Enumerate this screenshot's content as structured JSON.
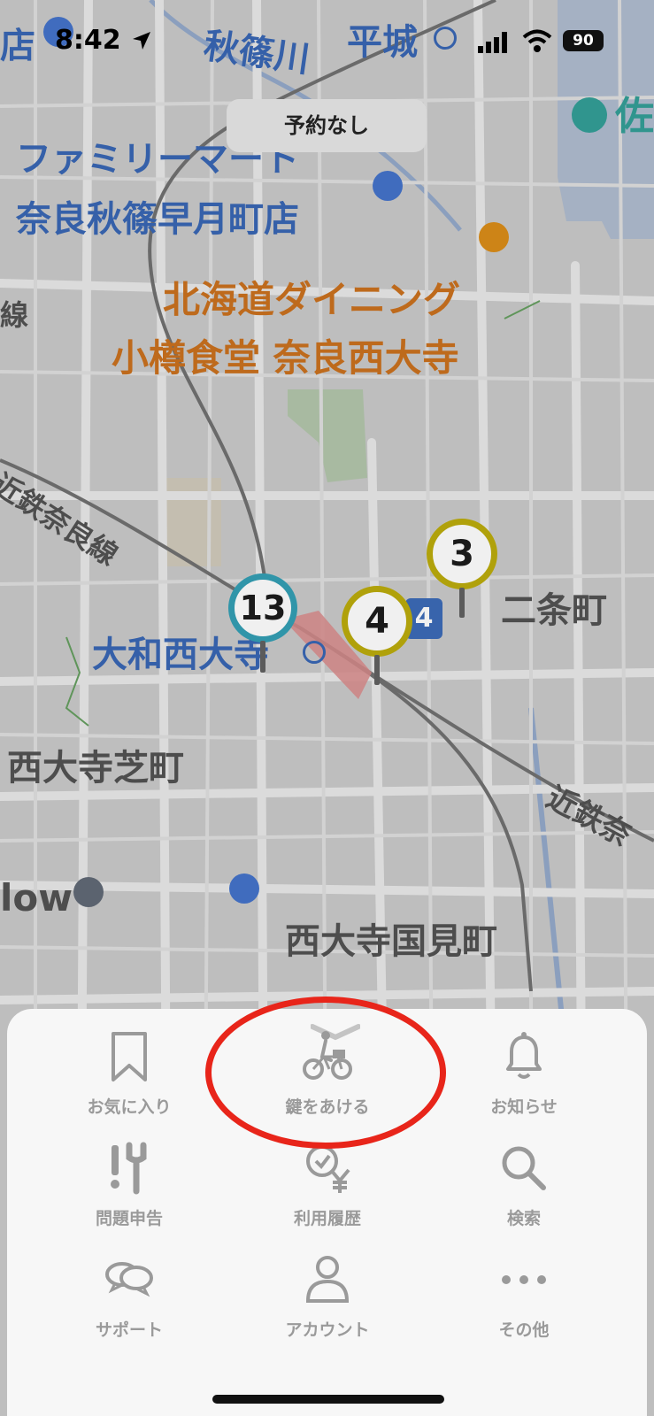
{
  "status_bar": {
    "time": "8:42",
    "battery": "90"
  },
  "reservation_status": "予約なし",
  "map_labels": {
    "edge_top_left": "店",
    "river": "秋篠川",
    "station_heijo": "平城",
    "edge_top_right": "佐",
    "familymart_line1": "ファミリーマート",
    "familymart_line2": "奈良秋篠早月町店",
    "restaurant_line1": "北海道ダイニング",
    "restaurant_line2": "小樽食堂 奈良西大寺",
    "edge_left": "線",
    "railway_west": "近鉄奈良線",
    "station_yamato": "大和西大寺",
    "nijo": "二条町",
    "shibamachi": "西大寺芝町",
    "railway_east": "近鉄奈",
    "edge_left_low": "low",
    "kunimi": "西大寺国見町",
    "route_badge": "4"
  },
  "markers": [
    {
      "count": "13",
      "color": "#2a9ab0"
    },
    {
      "count": "4",
      "color": "#b8a800"
    },
    {
      "count": "3",
      "color": "#b8a800"
    }
  ],
  "menu": [
    {
      "label": "お気に入り",
      "icon": "bookmark-icon"
    },
    {
      "label": "鍵をあける",
      "icon": "bike-person-icon"
    },
    {
      "label": "お知らせ",
      "icon": "bell-icon"
    },
    {
      "label": "問題申告",
      "icon": "wrench-warning-icon"
    },
    {
      "label": "利用履歴",
      "icon": "clock-yen-icon"
    },
    {
      "label": "検索",
      "icon": "search-icon"
    },
    {
      "label": "サポート",
      "icon": "chat-bubbles-icon"
    },
    {
      "label": "アカウント",
      "icon": "person-icon"
    },
    {
      "label": "その他",
      "icon": "more-dots-icon"
    }
  ],
  "colors": {
    "annotation": "#e8251a",
    "label_gray": "#9a9a9a",
    "map_blue": "#2f5fb0",
    "map_orange": "#c86a14"
  }
}
